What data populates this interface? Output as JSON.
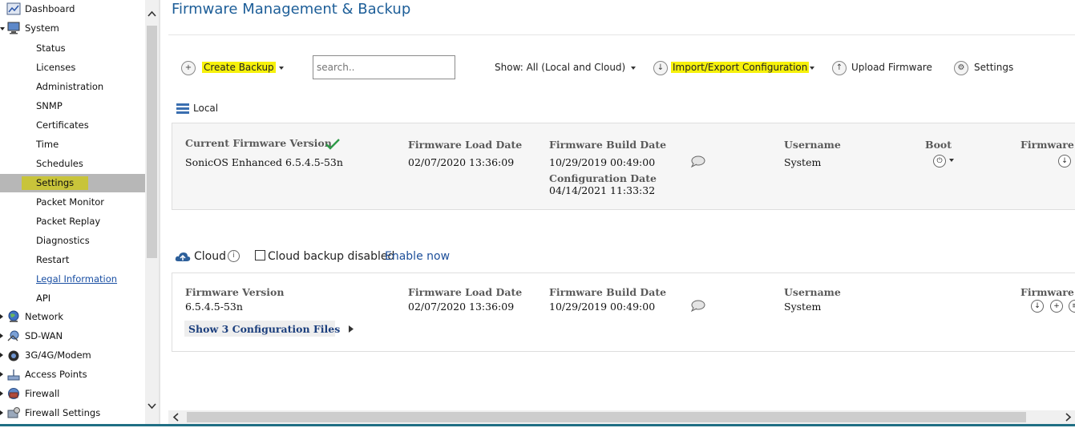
{
  "sidebar": {
    "items": [
      {
        "label": "Dashboard",
        "icon": "dashboard-icon"
      },
      {
        "label": "System",
        "icon": "system-icon"
      },
      {
        "label": "Status"
      },
      {
        "label": "Licenses"
      },
      {
        "label": "Administration"
      },
      {
        "label": "SNMP"
      },
      {
        "label": "Certificates"
      },
      {
        "label": "Time"
      },
      {
        "label": "Schedules"
      },
      {
        "label": "Settings",
        "selected": true
      },
      {
        "label": "Packet Monitor"
      },
      {
        "label": "Packet Replay"
      },
      {
        "label": "Diagnostics"
      },
      {
        "label": "Restart"
      },
      {
        "label": "Legal Information"
      },
      {
        "label": "API"
      },
      {
        "label": "Network",
        "icon": "network-globe-icon"
      },
      {
        "label": "SD-WAN",
        "icon": "sdwan-icon"
      },
      {
        "label": "3G/4G/Modem",
        "icon": "modem-icon"
      },
      {
        "label": "Access Points",
        "icon": "access-point-icon"
      },
      {
        "label": "Firewall",
        "icon": "firewall-icon"
      },
      {
        "label": "Firewall Settings",
        "icon": "firewall-settings-icon"
      }
    ]
  },
  "page": {
    "title": "Firmware Management & Backup"
  },
  "toolbar": {
    "create_backup": "Create Backup",
    "search_placeholder": "search..",
    "show_filter": "Show: All (Local and Cloud)",
    "import_export": "Import/Export Configuration",
    "upload_firmware": "Upload Firmware",
    "settings": "Settings"
  },
  "local": {
    "section_label": "Local",
    "headers": {
      "current_firmware": "Current Firmware Version",
      "load_date": "Firmware Load Date",
      "build_date": "Firmware Build Date",
      "config_date": "Configuration Date",
      "username": "Username",
      "boot": "Boot",
      "firmware_actions": "Firmware A"
    },
    "row": {
      "firmware": "SonicOS Enhanced 6.5.4.5-53n",
      "load_date": "02/07/2020 13:36:09",
      "build_date": "10/29/2019 00:49:00",
      "config_date": "04/14/2021 11:33:32",
      "username": "System"
    }
  },
  "cloud": {
    "section_label": "Cloud",
    "checkbox_label": "Cloud backup disabled",
    "checkbox_checked": false,
    "enable_link": "Enable now",
    "headers": {
      "firmware": "Firmware Version",
      "load_date": "Firmware Load Date",
      "build_date": "Firmware Build Date",
      "username": "Username",
      "firmware_actions": "Firmware A"
    },
    "row": {
      "firmware": "6.5.4.5-53n",
      "load_date": "02/07/2020 13:36:09",
      "build_date": "10/29/2019 00:49:00",
      "username": "System"
    },
    "show_files": "Show 3 Configuration Files"
  },
  "colors": {
    "title": "#1d5e98",
    "highlight": "#f6f10b",
    "selected_row": "#b7b7b7",
    "accent_link": "#1d4f9a"
  }
}
